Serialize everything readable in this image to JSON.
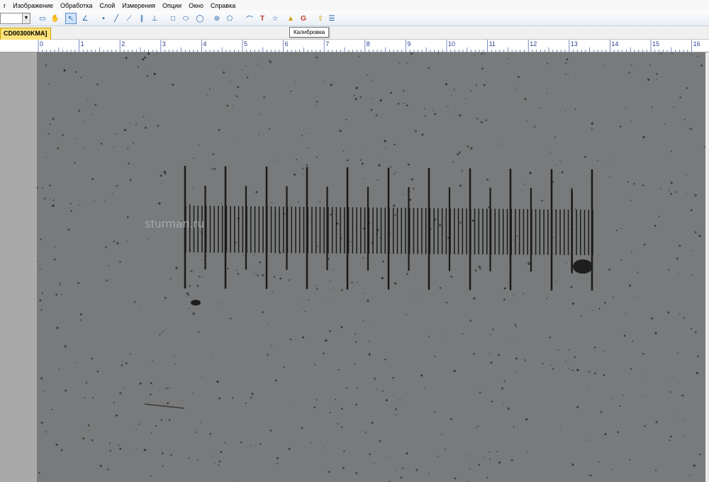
{
  "menu": [
    "г",
    "Изображение",
    "Обработка",
    "Слой",
    "Измерения",
    "Опции",
    "Окно",
    "Справка"
  ],
  "toolbar": {
    "combo_value": "",
    "icons": [
      "select-rect-icon",
      "hand-icon",
      "pointer-icon",
      "angle-icon",
      "point-icon",
      "line-icon",
      "polyline-icon",
      "parallel-icon",
      "perpendicular-icon",
      "rectangle-icon",
      "ellipse-icon",
      "circle-icon",
      "count-icon",
      "polygon-icon",
      "arc-icon",
      "text-icon",
      "star-icon",
      "calibration-icon",
      "g-icon",
      "export-icon",
      "stack-icon"
    ]
  },
  "tab": {
    "label": "CD00300KMA]"
  },
  "tooltip": {
    "text": "Калибровка"
  },
  "ruler": {
    "labels": [
      "0",
      "1",
      "2",
      "3",
      "4",
      "5",
      "6",
      "7",
      "8",
      "9",
      "10",
      "11",
      "12",
      "13",
      "14",
      "15",
      "16"
    ]
  },
  "image": {
    "watermark": "sturman.ru",
    "background": "#787a7b",
    "line_color": "#1a1a1a"
  }
}
